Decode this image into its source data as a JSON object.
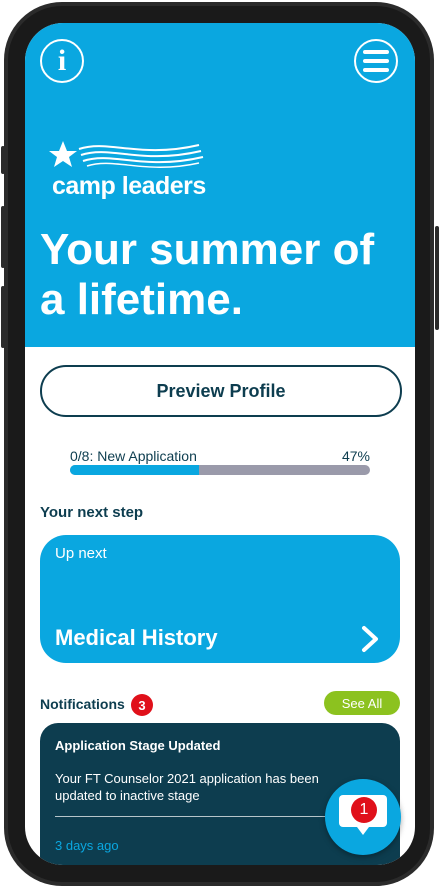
{
  "header": {
    "info_icon": "i",
    "menu_icon": "hamburger-icon",
    "logo_text": "camp leaders",
    "headline": "Your summer of a lifetime."
  },
  "profile": {
    "preview_label": "Preview Profile"
  },
  "progress": {
    "label": "0/8: New Application",
    "percent_text": "47%",
    "fraction": 0.43
  },
  "next_step": {
    "section_title": "Your next step",
    "up_next": "Up next",
    "title": "Medical History"
  },
  "notifications": {
    "title": "Notifications",
    "count": "3",
    "see_all": "See All",
    "items": [
      {
        "title": "Application Stage Updated",
        "body": "Your FT Counselor 2021 application has been updated to inactive stage",
        "time": "3 days ago"
      }
    ]
  },
  "chat": {
    "badge": "1"
  },
  "colors": {
    "brand_blue": "#0aa7e0",
    "dark_teal": "#0d3d4f",
    "green": "#8cc21f",
    "badge_red": "#e0101a"
  }
}
